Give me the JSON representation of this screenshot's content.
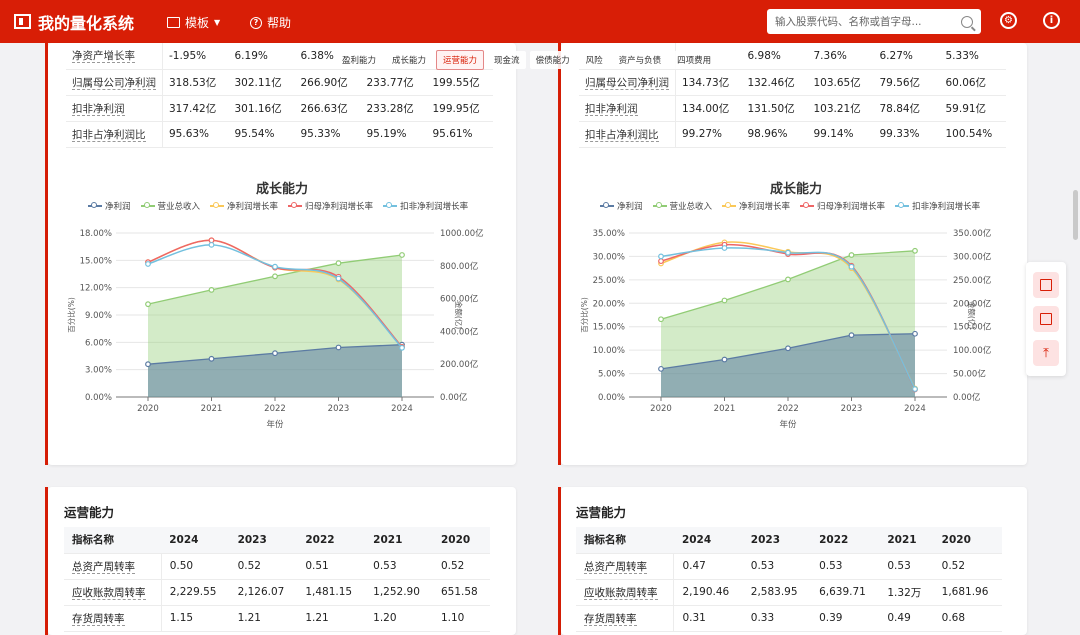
{
  "header": {
    "app_title": "我的量化系统",
    "nav_templates": "模板",
    "nav_help": "帮助",
    "search_placeholder": "输入股票代码、名称或首字母...",
    "help_glyph": "?",
    "info_glyph": "i"
  },
  "tabs": [
    {
      "label": "盈利能力",
      "active": false
    },
    {
      "label": "成长能力",
      "active": false
    },
    {
      "label": "运营能力",
      "active": true
    },
    {
      "label": "现金流",
      "active": false
    },
    {
      "label": "偿债能力",
      "active": false
    },
    {
      "label": "风险",
      "active": false
    },
    {
      "label": "资产与负债",
      "active": false
    },
    {
      "label": "四项费用",
      "active": false
    }
  ],
  "left": {
    "growth_table": [
      {
        "label": "净资产增长率",
        "values": [
          "-1.95%",
          "6.19%",
          "6.38%",
          "",
          ""
        ]
      },
      {
        "label": "归属母公司净利润",
        "values": [
          "318.53亿",
          "302.11亿",
          "266.90亿",
          "233.77亿",
          "199.55亿"
        ]
      },
      {
        "label": "扣非净利润",
        "values": [
          "317.42亿",
          "301.16亿",
          "266.63亿",
          "233.28亿",
          "199.95亿"
        ]
      },
      {
        "label": "扣非占净利润比",
        "values": [
          "95.63%",
          "95.54%",
          "95.33%",
          "95.19%",
          "95.61%"
        ]
      }
    ],
    "ops_title": "运营能力",
    "ops_headers": [
      "指标名称",
      "2024",
      "2023",
      "2022",
      "2021",
      "2020"
    ],
    "ops_rows": [
      {
        "label": "总资产周转率",
        "values": [
          "0.50",
          "0.52",
          "0.51",
          "0.53",
          "0.52"
        ]
      },
      {
        "label": "应收账款周转率",
        "values": [
          "2,229.55",
          "2,126.07",
          "1,481.15",
          "1,252.90",
          "651.58"
        ]
      },
      {
        "label": "存货周转率",
        "values": [
          "1.15",
          "1.21",
          "1.21",
          "1.20",
          "1.10"
        ]
      }
    ]
  },
  "right": {
    "growth_table": [
      {
        "label": "",
        "values": [
          "",
          "6.98%",
          "7.36%",
          "6.27%",
          "5.33%"
        ]
      },
      {
        "label": "归属母公司净利润",
        "values": [
          "134.73亿",
          "132.46亿",
          "103.65亿",
          "79.56亿",
          "60.06亿"
        ]
      },
      {
        "label": "扣非净利润",
        "values": [
          "134.00亿",
          "131.50亿",
          "103.21亿",
          "78.84亿",
          "59.91亿"
        ]
      },
      {
        "label": "扣非占净利润比",
        "values": [
          "99.27%",
          "98.96%",
          "99.14%",
          "99.33%",
          "100.54%"
        ]
      }
    ],
    "ops_title": "运营能力",
    "ops_headers": [
      "指标名称",
      "2024",
      "2023",
      "2022",
      "2021",
      "2020"
    ],
    "ops_rows": [
      {
        "label": "总资产周转率",
        "values": [
          "0.47",
          "0.53",
          "0.53",
          "0.53",
          "0.52"
        ]
      },
      {
        "label": "应收账款周转率",
        "values": [
          "2,190.46",
          "2,583.95",
          "6,639.71",
          "1.32万",
          "1,681.96"
        ]
      },
      {
        "label": "存货周转率",
        "values": [
          "0.31",
          "0.33",
          "0.39",
          "0.49",
          "0.68"
        ]
      }
    ]
  },
  "chart_data": [
    {
      "type": "area",
      "title": "成长能力",
      "xlabel": "年份",
      "ylabel_left": "百分比(%)",
      "ylabel_right": "金额(亿)",
      "categories": [
        "2020",
        "2021",
        "2022",
        "2023",
        "2024"
      ],
      "y_left_ticks": [
        "0.00%",
        "3.00%",
        "6.00%",
        "9.00%",
        "12.00%",
        "15.00%",
        "18.00%"
      ],
      "y_left_range": [
        0,
        18
      ],
      "y_right_ticks": [
        "0.00亿",
        "200.00亿",
        "400.00亿",
        "600.00亿",
        "800.00亿",
        "1000.00亿"
      ],
      "y_right_range": [
        0,
        1000
      ],
      "legend_position": "top",
      "series": [
        {
          "name": "净利润",
          "axis": "right",
          "color": "#5b7ba3",
          "area": true,
          "values": [
            200,
            233,
            267,
            302,
            319
          ]
        },
        {
          "name": "营业总收入",
          "axis": "right",
          "color": "#91cc75",
          "area": true,
          "values": [
            566,
            653,
            736,
            816,
            866
          ]
        },
        {
          "name": "净利润增长率",
          "axis": "left",
          "color": "#fac858",
          "area": false,
          "values": [
            14.8,
            17.2,
            14.2,
            12.9,
            5.5
          ]
        },
        {
          "name": "归母净利润增长率",
          "axis": "left",
          "color": "#ee6666",
          "area": false,
          "values": [
            14.8,
            17.2,
            14.2,
            13.2,
            5.5
          ]
        },
        {
          "name": "扣非净利润增长率",
          "axis": "left",
          "color": "#73c0de",
          "area": false,
          "values": [
            14.6,
            16.7,
            14.3,
            13.0,
            5.4
          ]
        }
      ]
    },
    {
      "type": "area",
      "title": "成长能力",
      "xlabel": "年份",
      "ylabel_left": "百分比(%)",
      "ylabel_right": "金额(亿)",
      "categories": [
        "2020",
        "2021",
        "2022",
        "2023",
        "2024"
      ],
      "y_left_ticks": [
        "0.00%",
        "5.00%",
        "10.00%",
        "15.00%",
        "20.00%",
        "25.00%",
        "30.00%",
        "35.00%"
      ],
      "y_left_range": [
        0,
        35
      ],
      "y_right_ticks": [
        "0.00亿",
        "50.00亿",
        "100.00亿",
        "150.00亿",
        "200.00亿",
        "250.00亿",
        "300.00亿",
        "350.00亿"
      ],
      "y_right_range": [
        0,
        350
      ],
      "legend_position": "top",
      "series": [
        {
          "name": "净利润",
          "axis": "right",
          "color": "#5b7ba3",
          "area": true,
          "values": [
            60,
            80,
            104,
            132,
            135
          ]
        },
        {
          "name": "营业总收入",
          "axis": "right",
          "color": "#91cc75",
          "area": true,
          "values": [
            166,
            206,
            251,
            303,
            312
          ]
        },
        {
          "name": "净利润增长率",
          "axis": "left",
          "color": "#fac858",
          "area": false,
          "values": [
            28.5,
            33.0,
            31.0,
            27.5,
            1.8
          ]
        },
        {
          "name": "归母净利润增长率",
          "axis": "left",
          "color": "#ee6666",
          "area": false,
          "values": [
            29.0,
            32.5,
            30.5,
            28.0,
            1.6
          ]
        },
        {
          "name": "扣非净利润增长率",
          "axis": "left",
          "color": "#73c0de",
          "area": false,
          "values": [
            30.0,
            31.8,
            30.8,
            27.8,
            1.7
          ]
        }
      ]
    }
  ]
}
